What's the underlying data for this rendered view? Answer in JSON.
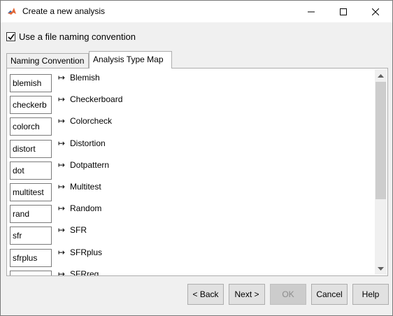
{
  "window": {
    "title": "Create a new analysis",
    "controls": [
      "minimize-icon",
      "maximize-icon",
      "close-icon"
    ]
  },
  "naming_convention": {
    "checked": true,
    "label": "Use a file naming convention"
  },
  "tabs": [
    {
      "label": "Naming Convention",
      "active": false
    },
    {
      "label": "Analysis Type Map",
      "active": true
    }
  ],
  "mappings": [
    {
      "key": "blemish",
      "value": "Blemish"
    },
    {
      "key": "checkerb",
      "value": "Checkerboard"
    },
    {
      "key": "colorch",
      "value": "Colorcheck"
    },
    {
      "key": "distort",
      "value": "Distortion"
    },
    {
      "key": "dot",
      "value": "Dotpattern"
    },
    {
      "key": "multitest",
      "value": "Multitest"
    },
    {
      "key": "rand",
      "value": "Random"
    },
    {
      "key": "sfr",
      "value": "SFR"
    },
    {
      "key": "sfrplus",
      "value": "SFRplus"
    },
    {
      "key": "",
      "value": "SFRreg"
    }
  ],
  "arrow_symbol": "↦",
  "buttons": {
    "back": "< Back",
    "next": "Next >",
    "ok": "OK",
    "cancel": "Cancel",
    "help": "Help"
  },
  "ok_enabled": false
}
